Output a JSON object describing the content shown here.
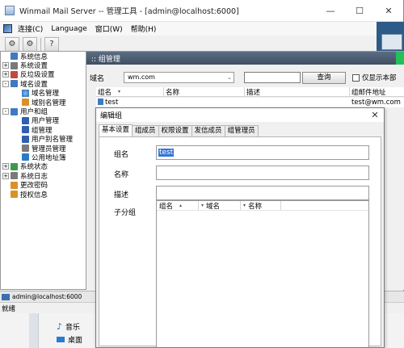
{
  "window": {
    "title": "Winmail Mail Server -- 管理工具 - [admin@localhost:6000]",
    "controls": {
      "minimize": "—",
      "maximize": "☐",
      "close": "✕"
    }
  },
  "menu": {
    "items": [
      "连接(C)",
      "Language",
      "窗口(W)",
      "帮助(H)"
    ]
  },
  "tree": {
    "items": [
      {
        "label": "系统信息",
        "expand": "",
        "indent": 0,
        "icon": "info-icon",
        "color": "blue"
      },
      {
        "label": "系统设置",
        "expand": "+",
        "indent": 0,
        "icon": "settings-icon",
        "color": "gray"
      },
      {
        "label": "反垃圾设置",
        "expand": "+",
        "indent": 0,
        "icon": "antispam-icon",
        "color": "red"
      },
      {
        "label": "域名设置",
        "expand": "-",
        "indent": 0,
        "icon": "domain-icon",
        "color": "blue"
      },
      {
        "label": "域名管理",
        "expand": "",
        "indent": 1,
        "icon": "globe-icon",
        "color": "globe"
      },
      {
        "label": "域别名管理",
        "expand": "",
        "indent": 1,
        "icon": "domain-alias-icon",
        "color": "orange"
      },
      {
        "label": "用户和组",
        "expand": "-",
        "indent": 0,
        "icon": "users-icon",
        "color": "blue"
      },
      {
        "label": "用户管理",
        "expand": "",
        "indent": 1,
        "icon": "user-icon",
        "color": "user"
      },
      {
        "label": "组管理",
        "expand": "",
        "indent": 1,
        "icon": "group-icon",
        "color": "user"
      },
      {
        "label": "用户别名管理",
        "expand": "",
        "indent": 1,
        "icon": "user-alias-icon",
        "color": "user"
      },
      {
        "label": "管理员管理",
        "expand": "",
        "indent": 1,
        "icon": "admin-icon",
        "color": "gray"
      },
      {
        "label": "公用地址簿",
        "expand": "",
        "indent": 1,
        "icon": "address-book-icon",
        "color": "book"
      },
      {
        "label": "系统状态",
        "expand": "+",
        "indent": 0,
        "icon": "status-icon",
        "color": "green"
      },
      {
        "label": "系统日志",
        "expand": "+",
        "indent": 0,
        "icon": "log-icon",
        "color": "gray"
      },
      {
        "label": "更改密码",
        "expand": "",
        "indent": 0,
        "icon": "password-icon",
        "color": "orange"
      },
      {
        "label": "授权信息",
        "expand": "",
        "indent": 0,
        "icon": "license-icon",
        "color": "orange"
      }
    ]
  },
  "panel": {
    "header": ":: 组管理",
    "domain_label": "域名",
    "domain_value": "wm.com",
    "query_button": "查询",
    "only_show_label": "仅显示本部",
    "columns": [
      "组名",
      "名称",
      "描述",
      "组邮件地址"
    ],
    "rows": [
      {
        "name": "test",
        "display": "",
        "desc": "",
        "email": "test@wm.com"
      }
    ]
  },
  "status": {
    "connection": "admin@localhost:6000",
    "ready": "就绪"
  },
  "dialog": {
    "title": "编辑组",
    "close": "✕",
    "tabs": [
      "基本设置",
      "组成员",
      "权限设置",
      "发信成员",
      "组管理员"
    ],
    "fields": {
      "group_name_label": "组名",
      "group_name_value": "test",
      "display_name_label": "名称",
      "description_label": "描述",
      "subgroups_label": "子分组"
    },
    "subgroup_columns": [
      "组名",
      "域名",
      "名称"
    ]
  },
  "desktop": {
    "items": [
      {
        "label": "音乐",
        "icon": "music-icon"
      },
      {
        "label": "桌面",
        "icon": "desktop-icon"
      }
    ]
  }
}
